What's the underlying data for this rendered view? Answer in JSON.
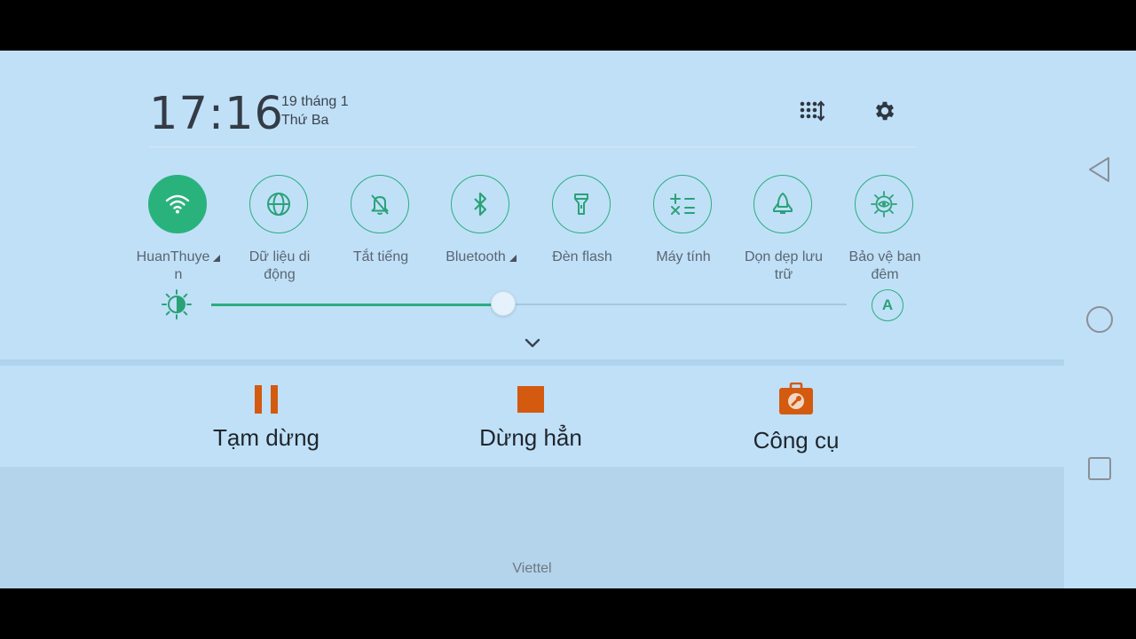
{
  "header": {
    "time": "17:16",
    "date": "19 tháng 1",
    "weekday": "Thứ Ba",
    "edit_icon": "grid-edit-icon",
    "settings_icon": "gear-icon"
  },
  "tiles": [
    {
      "label": "HuanThuye",
      "label2": "n",
      "icon": "wifi-icon",
      "active": true,
      "has_menu": true
    },
    {
      "label": "Dữ liệu di",
      "label2": "động",
      "icon": "globe-icon",
      "active": false
    },
    {
      "label": "Tắt tiếng",
      "icon": "bell-off-icon",
      "active": false
    },
    {
      "label": "Bluetooth",
      "icon": "bluetooth-icon",
      "active": false,
      "has_menu": true
    },
    {
      "label": "Đèn flash",
      "icon": "flashlight-icon",
      "active": false
    },
    {
      "label": "Máy tính",
      "icon": "calculator-icon",
      "active": false
    },
    {
      "label": "Dọn dẹp lưu",
      "label2": "trữ",
      "icon": "rocket-icon",
      "active": false
    },
    {
      "label": "Bảo vệ ban",
      "label2": "đêm",
      "icon": "eye-protection-icon",
      "active": false
    }
  ],
  "brightness": {
    "level": 0.46,
    "auto_label": "A"
  },
  "notification": {
    "actions": [
      {
        "label": "Tạm dừng",
        "icon": "pause-icon"
      },
      {
        "label": "Dừng hẳn",
        "icon": "stop-icon"
      },
      {
        "label": "Công cụ",
        "icon": "toolbox-icon"
      }
    ]
  },
  "carrier": "Viettel",
  "colors": {
    "accent": "#2ab27d",
    "action_orange": "#d35a0f",
    "panel_bg": "#c0e0f8"
  },
  "navbar": {
    "back_icon": "back-triangle-icon",
    "home_icon": "home-circle-icon",
    "recents_icon": "recents-square-icon"
  }
}
